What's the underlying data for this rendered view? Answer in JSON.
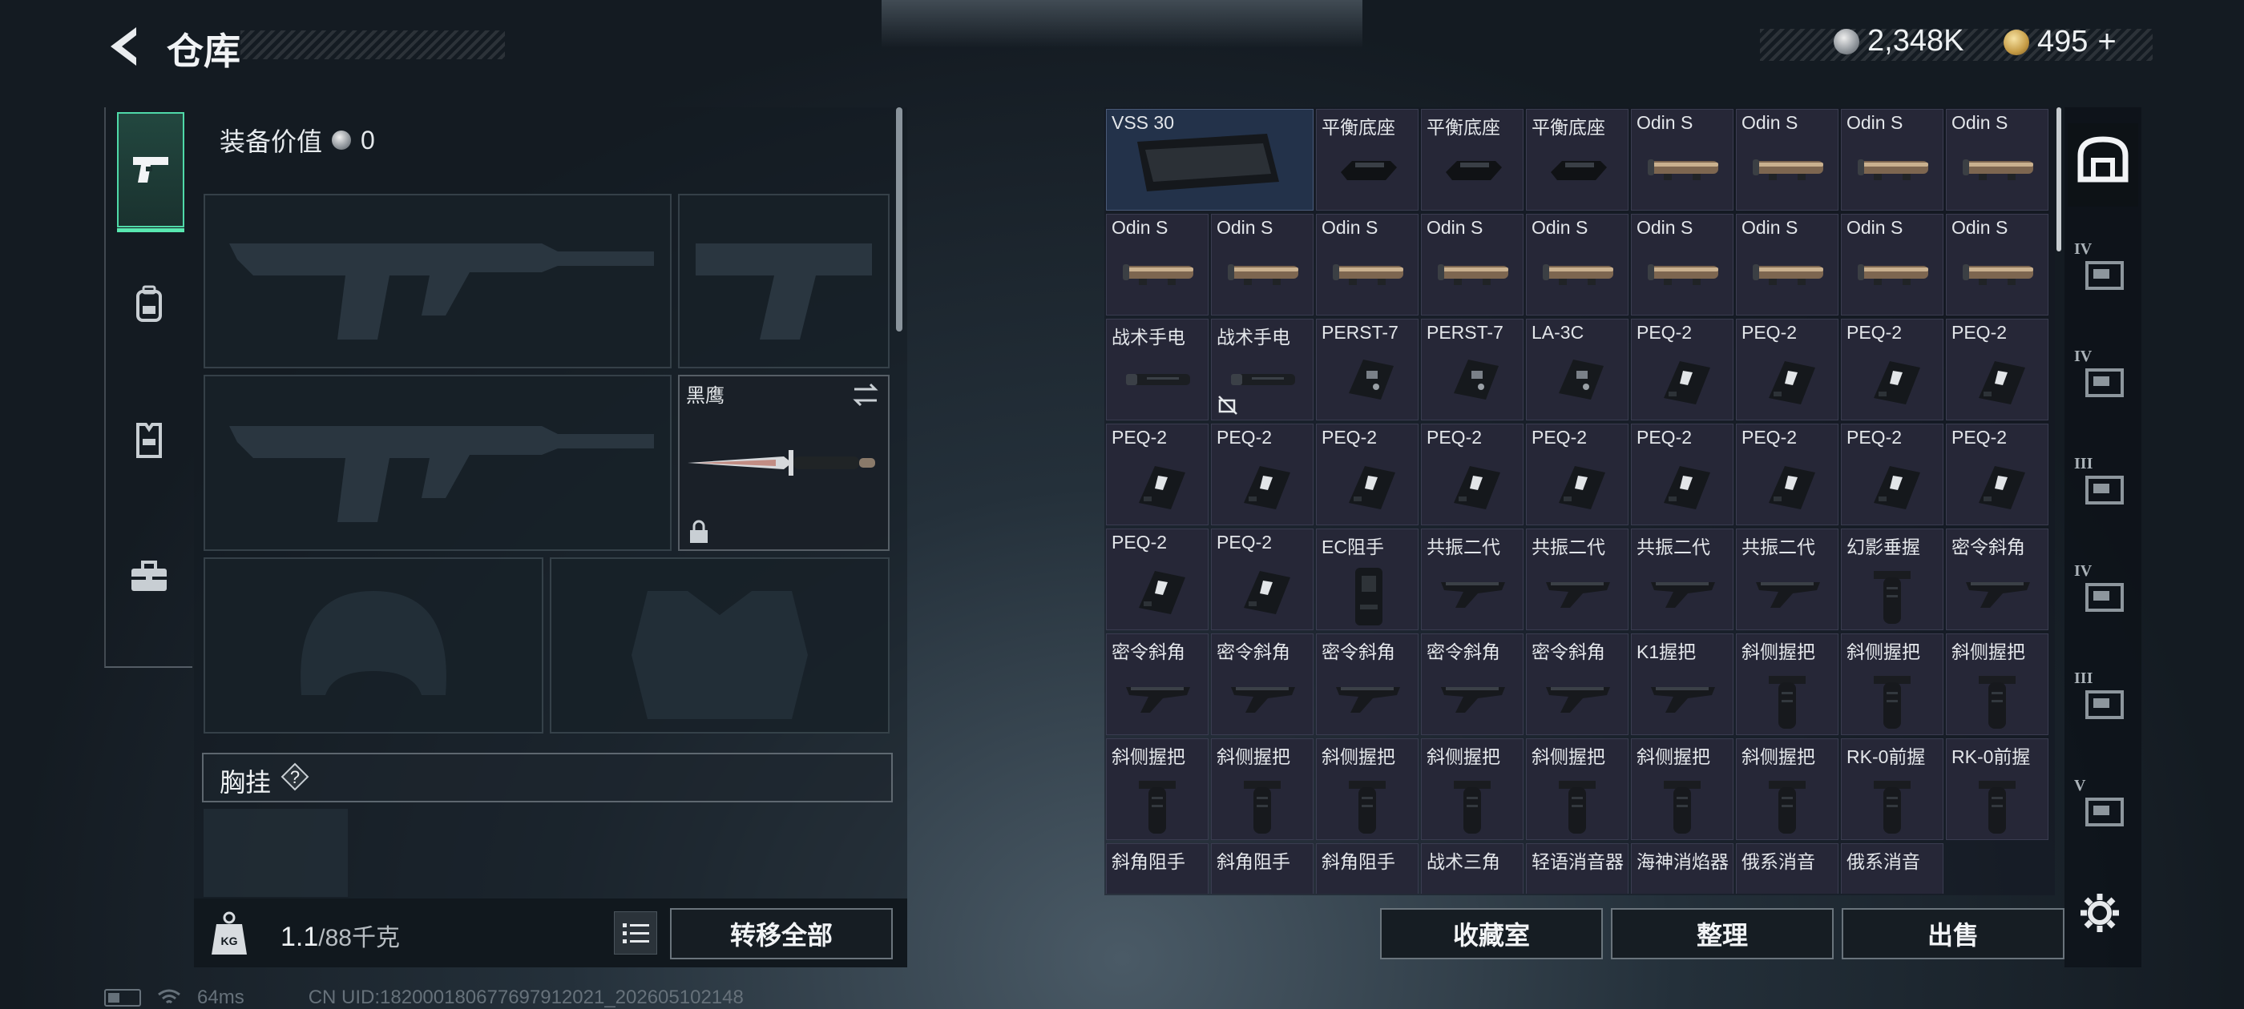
{
  "header": {
    "title": "仓库"
  },
  "currency": {
    "silver": "2,348K",
    "gold": "495",
    "gold_plus": "+"
  },
  "equipment": {
    "value_label": "装备价值",
    "value": "0",
    "melee_name": "黑鹰",
    "chest_label": "胸挂",
    "help": "?"
  },
  "weight": {
    "current": "1.1",
    "max": "/88千克"
  },
  "buttons": {
    "transfer_all": "转移全部",
    "collection": "收藏室",
    "sort": "整理",
    "sell": "出售"
  },
  "nav_icons": [
    "pistol-icon",
    "backpack-icon",
    "vest-icon",
    "toolbox-icon"
  ],
  "side_tiers": [
    "",
    "IV",
    "IV",
    "III",
    "IV",
    "III",
    "V"
  ],
  "grid_items": [
    {
      "name": "VSS 30",
      "icon": "magazine",
      "big": true
    },
    {
      "name": "平衡底座",
      "icon": "mount"
    },
    {
      "name": "平衡底座",
      "icon": "mount"
    },
    {
      "name": "平衡底座",
      "icon": "mount"
    },
    {
      "name": "Odin S",
      "icon": "scope"
    },
    {
      "name": "Odin S",
      "icon": "scope"
    },
    {
      "name": "Odin S",
      "icon": "scope"
    },
    {
      "name": "Odin S",
      "icon": "scope"
    },
    {
      "name": "Odin S",
      "icon": "scope"
    },
    {
      "name": "Odin S",
      "icon": "scope"
    },
    {
      "name": "Odin S",
      "icon": "scope"
    },
    {
      "name": "Odin S",
      "icon": "scope"
    },
    {
      "name": "Odin S",
      "icon": "scope"
    },
    {
      "name": "Odin S",
      "icon": "scope"
    },
    {
      "name": "Odin S",
      "icon": "scope"
    },
    {
      "name": "Odin S",
      "icon": "scope"
    },
    {
      "name": "Odin S",
      "icon": "scope"
    },
    {
      "name": "战术手电",
      "icon": "flashlight"
    },
    {
      "name": "战术手电",
      "icon": "flashlight",
      "no_sell": true
    },
    {
      "name": "PERST-7",
      "icon": "laser"
    },
    {
      "name": "PERST-7",
      "icon": "laser"
    },
    {
      "name": "LA-3C",
      "icon": "laser"
    },
    {
      "name": "PEQ-2",
      "icon": "peq"
    },
    {
      "name": "PEQ-2",
      "icon": "peq"
    },
    {
      "name": "PEQ-2",
      "icon": "peq"
    },
    {
      "name": "PEQ-2",
      "icon": "peq"
    },
    {
      "name": "PEQ-2",
      "icon": "peq"
    },
    {
      "name": "PEQ-2",
      "icon": "peq"
    },
    {
      "name": "PEQ-2",
      "icon": "peq"
    },
    {
      "name": "PEQ-2",
      "icon": "peq"
    },
    {
      "name": "PEQ-2",
      "icon": "peq"
    },
    {
      "name": "PEQ-2",
      "icon": "peq"
    },
    {
      "name": "PEQ-2",
      "icon": "peq"
    },
    {
      "name": "PEQ-2",
      "icon": "peq"
    },
    {
      "name": "PEQ-2",
      "icon": "peq"
    },
    {
      "name": "PEQ-2",
      "icon": "peq"
    },
    {
      "name": "PEQ-2",
      "icon": "peq"
    },
    {
      "name": "EC阻手",
      "icon": "holster"
    },
    {
      "name": "共振二代",
      "icon": "angled"
    },
    {
      "name": "共振二代",
      "icon": "angled"
    },
    {
      "name": "共振二代",
      "icon": "angled"
    },
    {
      "name": "共振二代",
      "icon": "angled"
    },
    {
      "name": "幻影垂握",
      "icon": "vgrip"
    },
    {
      "name": "密令斜角",
      "icon": "angled"
    },
    {
      "name": "密令斜角",
      "icon": "angled"
    },
    {
      "name": "密令斜角",
      "icon": "angled"
    },
    {
      "name": "密令斜角",
      "icon": "angled"
    },
    {
      "name": "密令斜角",
      "icon": "angled"
    },
    {
      "name": "密令斜角",
      "icon": "angled"
    },
    {
      "name": "K1握把",
      "icon": "angled"
    },
    {
      "name": "斜侧握把",
      "icon": "vgrip"
    },
    {
      "name": "斜侧握把",
      "icon": "vgrip"
    },
    {
      "name": "斜侧握把",
      "icon": "vgrip"
    },
    {
      "name": "斜侧握把",
      "icon": "vgrip"
    },
    {
      "name": "斜侧握把",
      "icon": "vgrip"
    },
    {
      "name": "斜侧握把",
      "icon": "vgrip"
    },
    {
      "name": "斜侧握把",
      "icon": "vgrip"
    },
    {
      "name": "斜侧握把",
      "icon": "vgrip"
    },
    {
      "name": "斜侧握把",
      "icon": "vgrip"
    },
    {
      "name": "斜侧握把",
      "icon": "vgrip"
    },
    {
      "name": "RK-0前握",
      "icon": "vgrip"
    },
    {
      "name": "RK-0前握",
      "icon": "vgrip"
    },
    {
      "name": "斜角阻手",
      "icon": "angled"
    },
    {
      "name": "斜角阻手",
      "icon": "angled"
    },
    {
      "name": "斜角阻手",
      "icon": "angled"
    },
    {
      "name": "战术三角",
      "icon": "angled"
    },
    {
      "name": "轻语消音器",
      "icon": "suppressor"
    },
    {
      "name": "海神消焰器",
      "icon": "suppressor"
    },
    {
      "name": "俄系消音",
      "icon": "suppressor"
    },
    {
      "name": "俄系消音",
      "icon": "suppressor"
    }
  ],
  "status": {
    "ping": "64ms",
    "uid": "CN UID:18200018067769791​2021_202605102148"
  },
  "colors": {
    "accent": "#4fd9a8",
    "cell_bg": "#262737",
    "selected_bg": "#23324a"
  }
}
